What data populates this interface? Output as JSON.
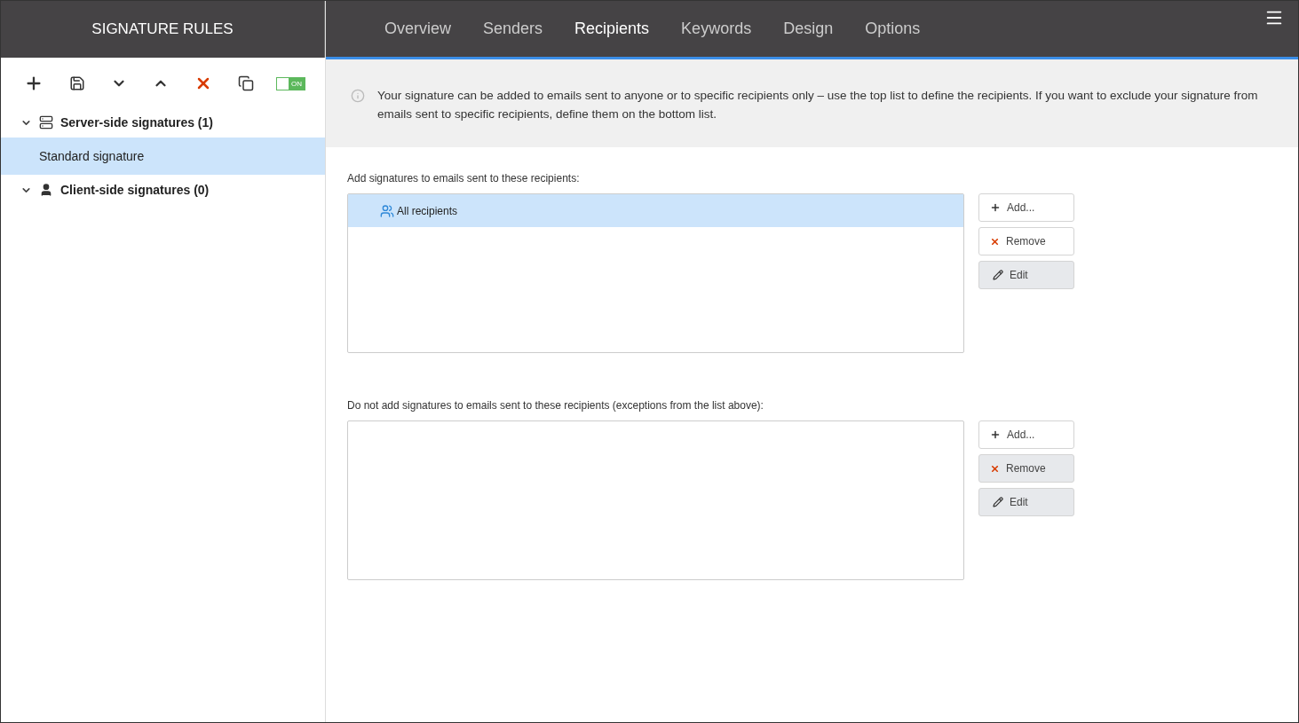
{
  "sidebar": {
    "title": "SIGNATURE RULES",
    "toolbar": [
      {
        "kind": "add"
      },
      {
        "kind": "save"
      },
      {
        "kind": "down"
      },
      {
        "kind": "up"
      },
      {
        "kind": "delete"
      },
      {
        "kind": "copy"
      },
      {
        "kind": "toggle",
        "on": true,
        "label": "ON"
      }
    ],
    "tree": [
      {
        "kind": "server",
        "label": "Server-side signatures (1)",
        "expanded": true,
        "children": [
          {
            "label": "Standard signature",
            "selected": true
          }
        ]
      },
      {
        "kind": "client",
        "label": "Client-side signatures (0)",
        "expanded": true
      }
    ]
  },
  "tabs": [
    {
      "label": "Overview",
      "selected": false
    },
    {
      "label": "Senders",
      "selected": false
    },
    {
      "label": "Recipients",
      "selected": true
    },
    {
      "label": "Keywords",
      "selected": false
    },
    {
      "label": "Design",
      "selected": false
    },
    {
      "label": "Options",
      "selected": false
    }
  ],
  "info": "Your signature can be added to emails sent to anyone or to specific recipients only – use the top list to define the recipients. If you want to exclude your signature from emails sent to specific recipients, define them on the bottom list.",
  "lists": [
    {
      "caption": "Add signatures to emails sent to these recipients:",
      "items": [
        {
          "label": "All recipients",
          "selected": true
        }
      ],
      "buttons": [
        {
          "kind": "add",
          "label": "Add...",
          "disabled": false
        },
        {
          "kind": "remove",
          "label": "Remove",
          "disabled": false
        },
        {
          "kind": "edit",
          "label": "Edit",
          "disabled": true
        }
      ]
    },
    {
      "caption": "Do not add signatures to emails sent to these recipients (exceptions from the list above):",
      "buttons": [
        {
          "kind": "add",
          "label": "Add...",
          "disabled": false
        },
        {
          "kind": "remove",
          "label": "Remove",
          "disabled": true
        },
        {
          "kind": "edit",
          "label": "Edit",
          "disabled": true
        }
      ]
    }
  ]
}
